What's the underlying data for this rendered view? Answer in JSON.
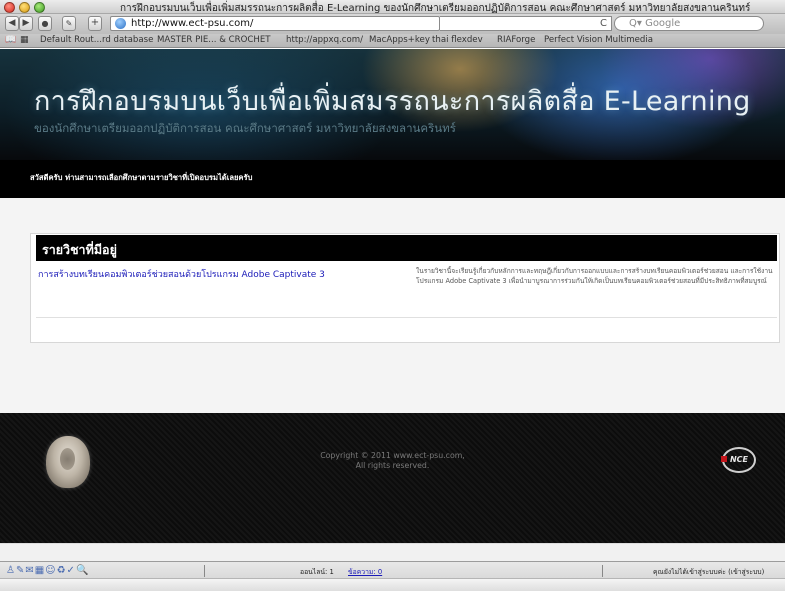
{
  "window": {
    "title": "การฝึกอบรมบนเว็บเพื่อเพิ่มสมรรถนะการผลิตสื่อ E-Learning ของนักศึกษาเตรียมออกปฏิบัติการสอน คณะศึกษาศาสตร์ มหาวิทยาลัยสงขลานครินทร์"
  },
  "toolbar": {
    "back": "◀",
    "forward": "▶",
    "url": "http://www.ect-psu.com/",
    "reload": "C",
    "search_placeholder": "Q▾ Google"
  },
  "bookmarks": [
    "Default Rout...rd database",
    "MASTER PIE... & CROCHET",
    "http://appxq.com/",
    "MacApps+key",
    "thai flexdev",
    "RIAForge",
    "Perfect Vision Multimedia"
  ],
  "hero": {
    "title": "การฝึกอบรมบนเว็บเพื่อเพิ่มสมรรถนะการผลิตสื่อ E-Learning",
    "subtitle": "ของนักศึกษาเตรียมออกปฏิบัติการสอน คณะศึกษาศาสตร์ มหาวิทยาลัยสงขลานครินทร์"
  },
  "welcome": "สวัสดีครับ ท่านสามารถเลือกศึกษาตามรายวิชาที่เปิดอบรมได้เลยครับ",
  "courses": {
    "heading": "รายวิชาที่มีอยู่",
    "items": [
      {
        "name": "การสร้างบทเรียนคอมพิวเตอร์ช่วยสอนด้วยโปรแกรม Adobe Captivate 3",
        "description": "ในรายวิชานี้จะเรียนรู้เกี่ยวกับหลักการและทฤษฎีเกี่ยวกับการออกแบบและการสร้างบทเรียนคอมพิวเตอร์ช่วยสอน และการใช้งานโปรแกรม Adobe Captivate 3 เพื่อนำมาบูรณาการร่วมกันให้เกิดเป็นบทเรียนคอมพิวเตอร์ช่วยสอนที่มีประสิทธิภาพที่สมบูรณ์"
      }
    ]
  },
  "footer": {
    "copyright_line1": "Copyright © 2011 www.ect-psu.com,",
    "copyright_line2": "All rights reserved.",
    "logo_text": "NCE"
  },
  "statusbar": {
    "online": "ออนไลน์: 1",
    "messages": "ข้อความ: 0",
    "login_status": "คุณยังไม่ได้เข้าสู่ระบบค่ะ (เข้าสู่ระบบ)"
  }
}
